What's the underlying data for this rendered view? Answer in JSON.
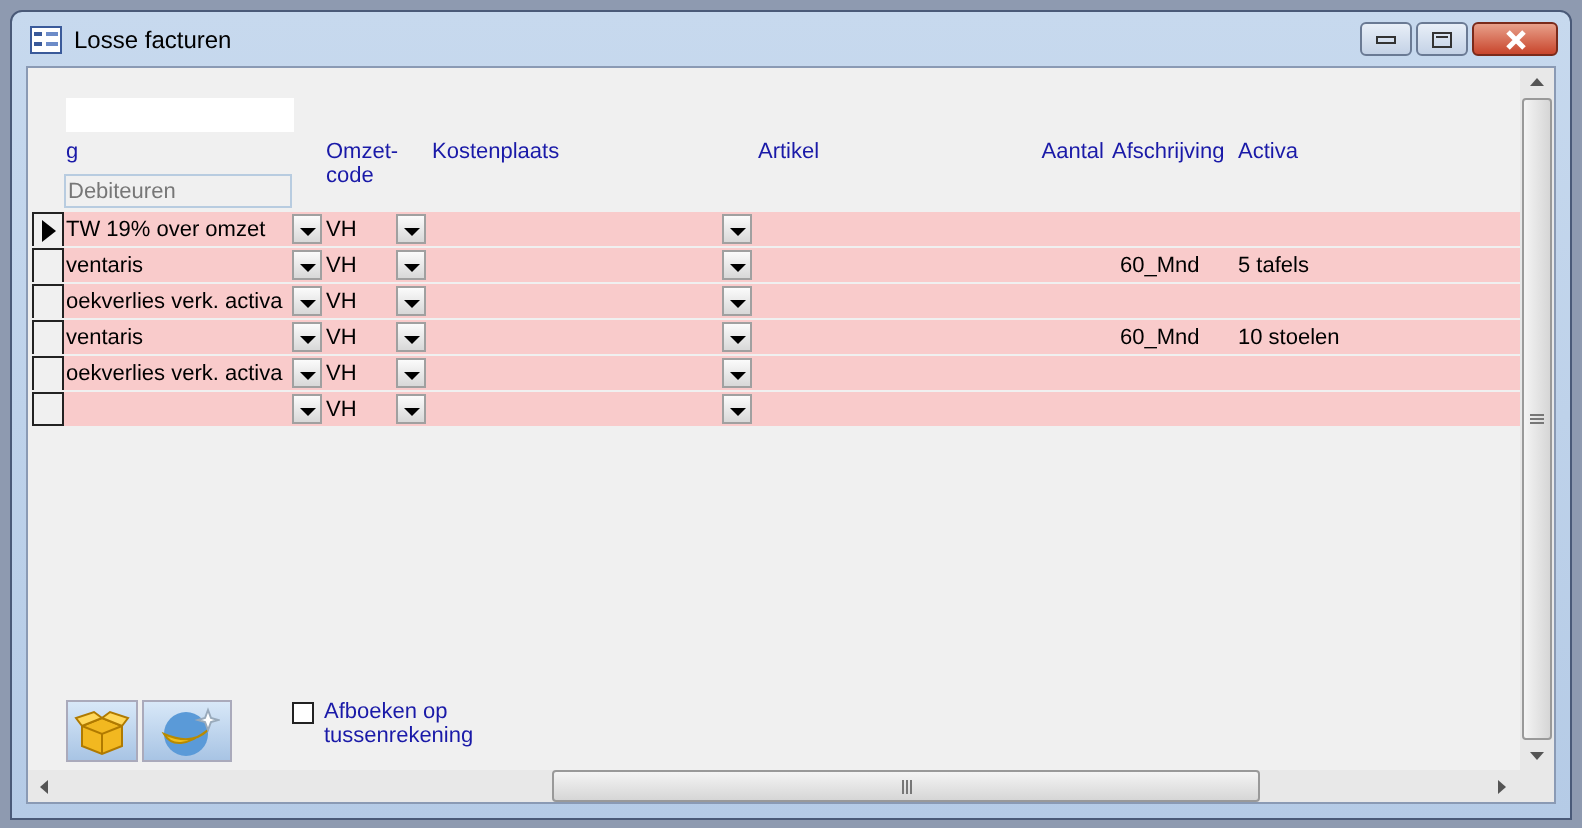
{
  "window": {
    "title": "Losse facturen"
  },
  "columns": [
    "g",
    "Omzet-code",
    "Kostenplaats",
    "Artikel",
    "Aantal",
    "Afschrijving",
    "Activa"
  ],
  "filter_value": "Debiteuren",
  "rows": [
    {
      "current": true,
      "account": "TW 19% over omzet",
      "omzetcode": "VH"
    },
    {
      "current": false,
      "account": "ventaris",
      "omzetcode": "VH",
      "afschrijving": "60_Mnd",
      "activa": "5 tafels"
    },
    {
      "current": false,
      "account": "oekverlies verk. activa",
      "omzetcode": "VH"
    },
    {
      "current": false,
      "account": "ventaris",
      "omzetcode": "VH",
      "afschrijving": "60_Mnd",
      "activa": "10 stoelen"
    },
    {
      "current": false,
      "account": "oekverlies verk. activa",
      "omzetcode": "VH"
    },
    {
      "current": false,
      "omzetcode": "VH"
    }
  ],
  "option": {
    "label": "Afboeken op tussenrekening",
    "checked": false
  }
}
